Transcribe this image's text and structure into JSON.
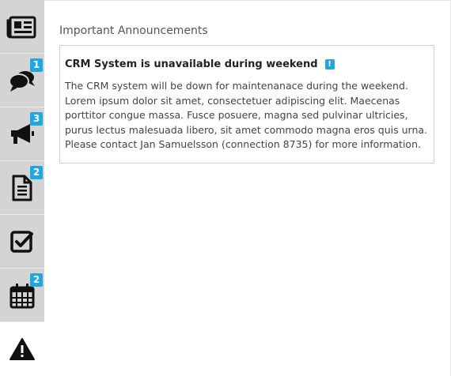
{
  "sidebar": {
    "tabs": [
      {
        "name": "news",
        "icon": "newspaper-icon",
        "badge": null,
        "active": false
      },
      {
        "name": "messages",
        "icon": "speech-bubbles-icon",
        "badge": "1",
        "active": false
      },
      {
        "name": "campaigns",
        "icon": "megaphone-icon",
        "badge": "3",
        "active": false
      },
      {
        "name": "documents",
        "icon": "document-icon",
        "badge": "2",
        "active": false
      },
      {
        "name": "tasks",
        "icon": "checkbox-icon",
        "badge": null,
        "active": false
      },
      {
        "name": "calendar",
        "icon": "calendar-icon",
        "badge": "2",
        "active": false
      },
      {
        "name": "announcements",
        "icon": "warning-icon",
        "badge": null,
        "active": true
      }
    ]
  },
  "main": {
    "section_title": "Important Announcements",
    "announcement": {
      "title": "CRM System is unavailable during weekend",
      "info_badge": "!",
      "body": "The CRM system will be down for maintenanace during the weekend. Lorem ipsum dolor sit amet, consectetuer adipiscing elit. Maecenas porttitor congue massa. Fusce posuere, magna sed pulvinar ultricies, purus lectus malesuada libero, sit amet commodo magna eros quis urna. Please contact Jan Samuelsson (connection 8735) for more information."
    }
  },
  "colors": {
    "sidebar_bg": "#d6d6d6",
    "badge": "#1fa7e0",
    "icon": "#111111"
  }
}
